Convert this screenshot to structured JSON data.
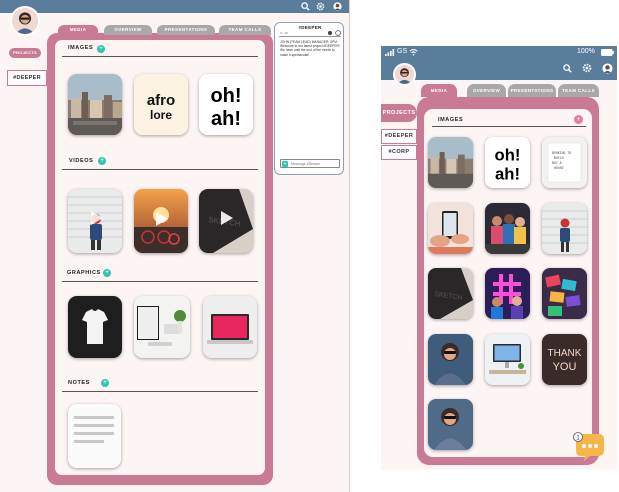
{
  "desktop": {
    "side_projects": "PROJECTS",
    "side_tag": "#DEEPER",
    "tabs": [
      "MEDIA",
      "OVERVIEW",
      "PRESENTATIONS",
      "TEAM CALLS"
    ],
    "sections": {
      "images": "IMAGES",
      "videos": "VIDEOS",
      "graphics": "GRAPHICS",
      "notes": "NOTES"
    },
    "plus_glyph": "+",
    "chat": {
      "title": "#DEEPER",
      "meta": "3 • 16",
      "message": "JOHN (TEAM LEAD) MANAGER: 5PM Welcome to our latest project #DEEPER! We have until the end of the month to make it spectacular!",
      "input_placeholder": "Message #Deeper"
    }
  },
  "phone": {
    "status": {
      "carrier": "GS",
      "battery": "100%"
    },
    "projects": "PROJECTS",
    "tags": [
      "#DEEPER",
      "#CORP"
    ],
    "tabs": [
      "MEDIA",
      "OVERVIEW",
      "PRESENTATIONS",
      "TEAM CALLS"
    ],
    "section": "IMAGES",
    "plus_glyph": "+",
    "notification_count": "1",
    "thumb_texts": {
      "ohah": "oh! ah!",
      "note_card": "BOOKING TO BUILD BUY A HOUSE",
      "thank": "THANK YOU",
      "sketch": "SKETCH"
    }
  },
  "desktop_thumb_texts": {
    "afro": "afro lore",
    "ohah": "oh! ah!",
    "sketch": "SKETCH"
  },
  "colors": {
    "accent_pink": "#c97b96",
    "header_blue": "#5a7d9c",
    "teal": "#2fc5b4",
    "chat_bubble": "#f5b547",
    "tab_gray": "#a8a8a8"
  },
  "icons": [
    "search-icon",
    "gear-icon",
    "avatar",
    "plus-icon",
    "play-icon",
    "signal-icon",
    "wifi-icon",
    "battery-icon",
    "chat-bubble-icon"
  ]
}
